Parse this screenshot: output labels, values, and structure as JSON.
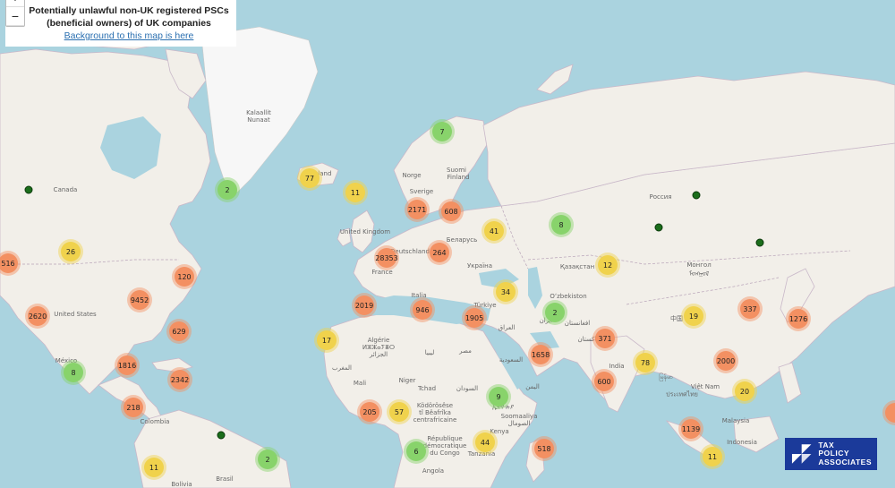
{
  "info": {
    "title_line1": "Potentially unlawful non-UK registered PSCs",
    "title_line2": "(beneficial owners) of UK companies",
    "background_link": "Background to this map is here"
  },
  "zoom": {
    "in": "+",
    "out": "−"
  },
  "logo": {
    "line1": "TAX",
    "line2": "POLICY",
    "line3": "ASSOCIATES"
  },
  "labels": {
    "kalaallit": "Kalaallit",
    "nunaat": "Nunaat",
    "canada": "Canada",
    "iceland": "Ísland",
    "norge": "Norge",
    "suomi": "Suomi",
    "finland": "Finland",
    "sverige": "Sverige",
    "uk": "United Kingdom",
    "deutschland": "Deutschland",
    "belarus": "Беларусь",
    "ukraina": "Україна",
    "russia": "Россия",
    "kazakhstan": "Қазақстан",
    "mongol": "Монгол",
    "mongol2": "ᠮᠣᠩᠭᠣᠯ",
    "france": "France",
    "italia": "Italia",
    "turkiye": "Türkiye",
    "uzbekiston": "Oʻzbekiston",
    "afghanistan": "افغانستان",
    "pakistan": "پاکستان",
    "iran": "ایران",
    "iraq": "العراق",
    "misr": "مصر",
    "saudi": "السعودية",
    "libya": "ليبيا",
    "algerie": "Algérie",
    "algerie2": "ⵍⵣⵣⴰⵢⴻⵔ",
    "algerie3": "الجزائر",
    "maroc": "المغرب",
    "mali": "Mali",
    "niger": "Niger",
    "tchad": "Tchad",
    "sudan": "السودان",
    "ethiopia": "ኢትዮጵያ",
    "kodorosese": "Ködörösêse",
    "kodorosese2": "tî Bêafrîka",
    "kodorosese3": "centrafricaine",
    "soomaaliya": "Soomaaliya",
    "soomaaliya2": "الصومال",
    "kenya": "Kenya",
    "tanzania": "Tanzania",
    "rdc": "République",
    "rdc2": "démocratique",
    "rdc3": "du Congo",
    "angola": "Angola",
    "india": "India",
    "china": "中国",
    "myanmar": "မြန်မာ",
    "vietnam": "Việt Nam",
    "thailand": "ประเทศไทย",
    "malaysia": "Malaysia",
    "indonesia": "Indonesia",
    "us": "United States",
    "mexico": "México",
    "colombia": "Colombia",
    "brasil": "Brasil",
    "bolivia": "Bolivia",
    "yemen": "اليمن"
  },
  "clusters": [
    {
      "label": "7",
      "size": "small"
    },
    {
      "label": "77",
      "size": "medium"
    },
    {
      "label": "2",
      "size": "small"
    },
    {
      "label": "11",
      "size": "medium"
    },
    {
      "label": "2171",
      "size": "large"
    },
    {
      "label": "608",
      "size": "large"
    },
    {
      "label": "41",
      "size": "medium"
    },
    {
      "label": "8",
      "size": "small"
    },
    {
      "label": "26",
      "size": "medium"
    },
    {
      "label": "516",
      "size": "large"
    },
    {
      "label": "28353",
      "size": "large"
    },
    {
      "label": "264",
      "size": "large"
    },
    {
      "label": "12",
      "size": "medium"
    },
    {
      "label": "120",
      "size": "large"
    },
    {
      "label": "9452",
      "size": "large"
    },
    {
      "label": "34",
      "size": "medium"
    },
    {
      "label": "2019",
      "size": "large"
    },
    {
      "label": "946",
      "size": "large"
    },
    {
      "label": "1905",
      "size": "large"
    },
    {
      "label": "2",
      "size": "small"
    },
    {
      "label": "337",
      "size": "large"
    },
    {
      "label": "1276",
      "size": "large"
    },
    {
      "label": "2620",
      "size": "large"
    },
    {
      "label": "19",
      "size": "medium"
    },
    {
      "label": "629",
      "size": "large"
    },
    {
      "label": "17",
      "size": "medium"
    },
    {
      "label": "371",
      "size": "large"
    },
    {
      "label": "1816",
      "size": "large"
    },
    {
      "label": "1658",
      "size": "large"
    },
    {
      "label": "78",
      "size": "medium"
    },
    {
      "label": "2000",
      "size": "large"
    },
    {
      "label": "8",
      "size": "small"
    },
    {
      "label": "2342",
      "size": "large"
    },
    {
      "label": "600",
      "size": "large"
    },
    {
      "label": "20",
      "size": "medium"
    },
    {
      "label": "9",
      "size": "small"
    },
    {
      "label": "218",
      "size": "large"
    },
    {
      "label": "205",
      "size": "large"
    },
    {
      "label": "57",
      "size": "medium"
    },
    {
      "label": "1139",
      "size": "large"
    },
    {
      "label": "44",
      "size": "medium"
    },
    {
      "label": "6",
      "size": "small"
    },
    {
      "label": "518",
      "size": "large"
    },
    {
      "label": "2",
      "size": "small"
    },
    {
      "label": "11",
      "size": "medium"
    },
    {
      "label": "11",
      "size": "medium"
    }
  ],
  "colors": {
    "water": "#aad3df",
    "land": "#f2efe9",
    "small": "#88d36b",
    "medium": "#f0d24c",
    "large": "#f39062",
    "logo_bg": "#1b3a9a"
  }
}
